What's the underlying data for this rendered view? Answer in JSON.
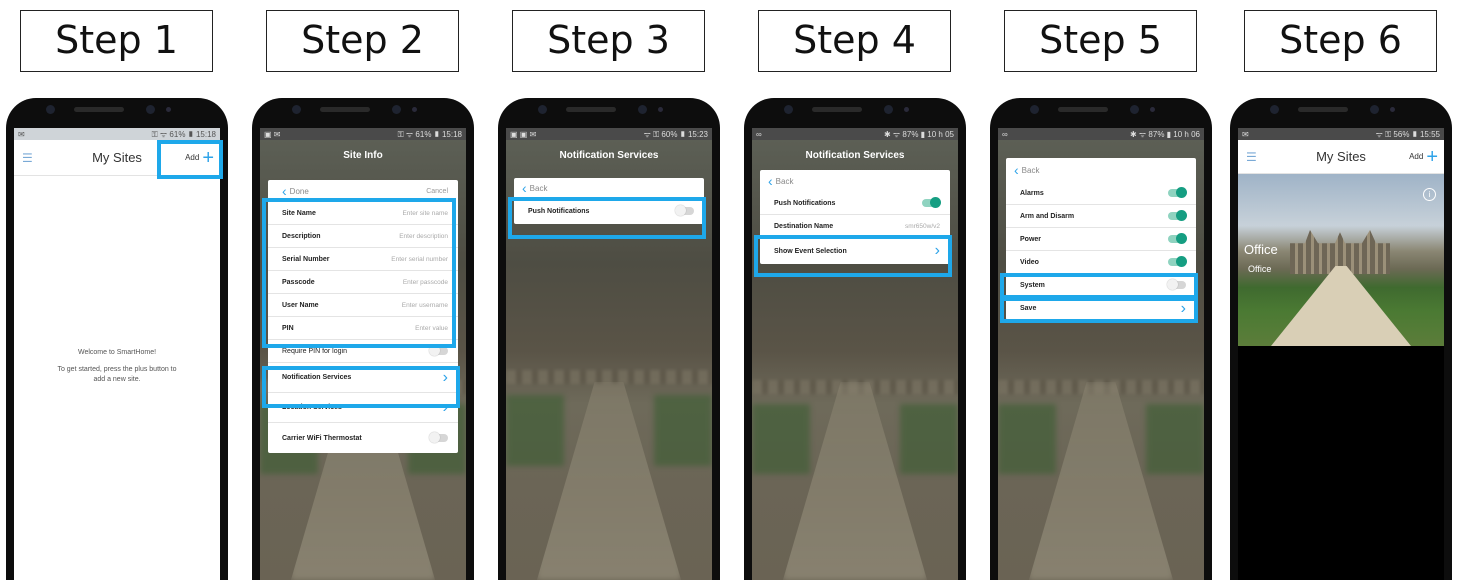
{
  "steps": [
    {
      "label": "Step 1"
    },
    {
      "label": "Step 2"
    },
    {
      "label": "Step 3"
    },
    {
      "label": "Step 4"
    },
    {
      "label": "Step 5"
    },
    {
      "label": "Step 6"
    }
  ],
  "highlight_color": "#1ea8ea",
  "accent_color": "#2ea3e8",
  "toggle_on_color": "#159e82",
  "s1": {
    "status_right": "⚿ ᯤ 61% ▮ 15:18",
    "title": "My Sites",
    "add_label": "Add",
    "welcome": "Welcome to SmartHome!",
    "hint": "To get started, press the plus button to add a new site."
  },
  "s2": {
    "status_right": "⚿ ᯤ 61% ▮ 15:18",
    "title": "Site Info",
    "done": "Done",
    "cancel": "Cancel",
    "fields": [
      {
        "label": "Site Name",
        "placeholder": "Enter site name"
      },
      {
        "label": "Description",
        "placeholder": "Enter description"
      },
      {
        "label": "Serial Number",
        "placeholder": "Enter serial number"
      },
      {
        "label": "Passcode",
        "placeholder": "Enter passcode"
      },
      {
        "label": "User Name",
        "placeholder": "Enter username"
      },
      {
        "label": "PIN",
        "placeholder": "Enter value"
      }
    ],
    "require_pin": "Require PIN for login",
    "notification_services": "Notification Services",
    "location_services": "Location Services",
    "carrier_wifi": "Carrier WiFi Thermostat"
  },
  "s3": {
    "status_right": "ᯤ ⚿ 60% ▮ 15:23",
    "title": "Notification Services",
    "back": "Back",
    "push": "Push Notifications"
  },
  "s4": {
    "status_right": "✱ ᯤ 87% ▮ 10 h 05",
    "title": "Notification Services",
    "back": "Back",
    "push": "Push Notifications",
    "destination": "Destination Name",
    "destination_value": "smr650w/v2",
    "show_events": "Show Event Selection"
  },
  "s5": {
    "status_right": "✱ ᯤ 87% ▮ 10 h 06",
    "back": "Back",
    "alarms": "Alarms",
    "arm": "Arm and Disarm",
    "power": "Power",
    "video": "Video",
    "system": "System",
    "save": "Save"
  },
  "s6": {
    "status_right": "ᯤ ⚿ 56% ▮ 15:55",
    "title": "My Sites",
    "add_label": "Add",
    "site_name": "Office",
    "site_sub": "Office"
  }
}
